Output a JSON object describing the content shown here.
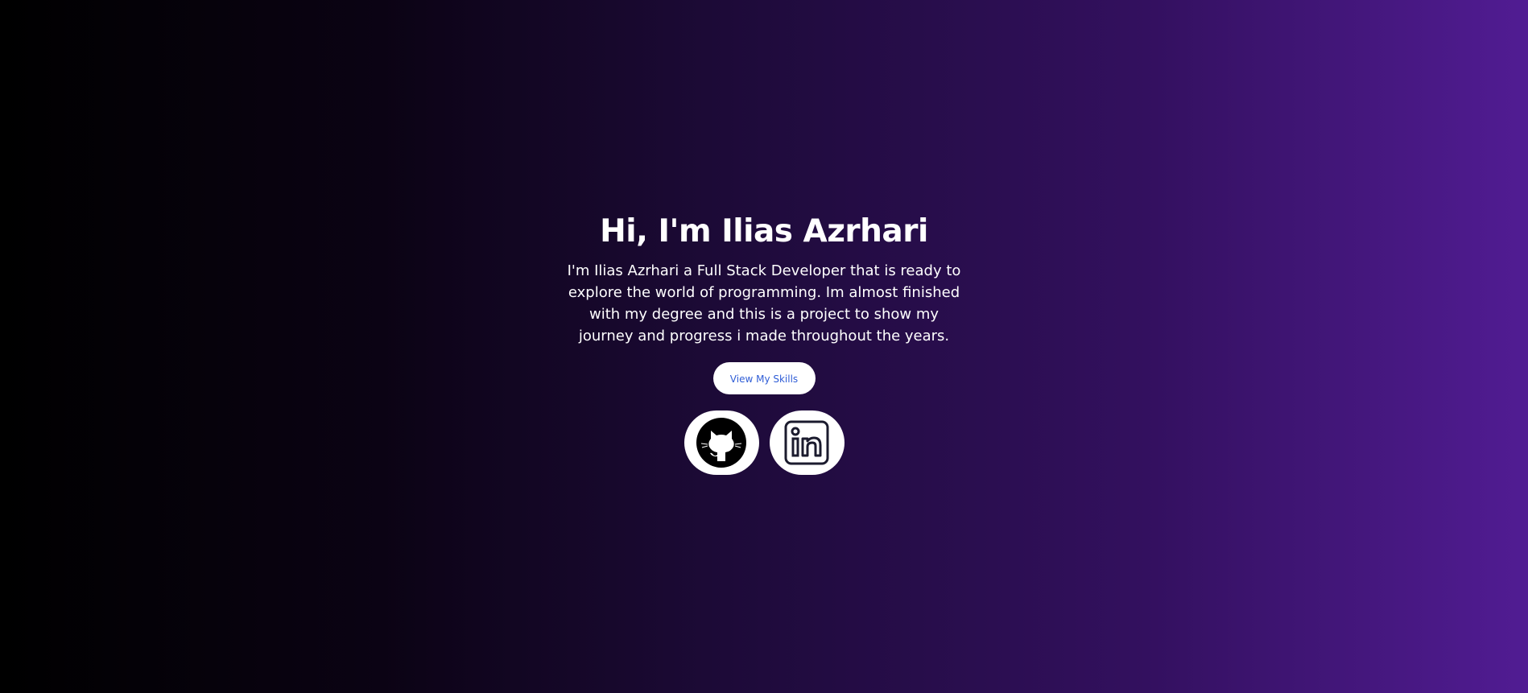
{
  "hero": {
    "title": "Hi, I'm Ilias Azrhari",
    "description": "I'm Ilias Azrhari a Full Stack Developer that is ready to explore the world of programming. Im almost finished with my degree and this is a project to show my journey and progress i made throughout the years.",
    "cta_label": "View My Skills"
  },
  "socials": [
    {
      "icon": "github-icon"
    },
    {
      "icon": "linkedin-icon"
    }
  ],
  "colors": {
    "gradient_start": "#000000",
    "gradient_end": "#511c93",
    "button_bg": "#ffffff",
    "button_text": "#2f5dd6"
  }
}
